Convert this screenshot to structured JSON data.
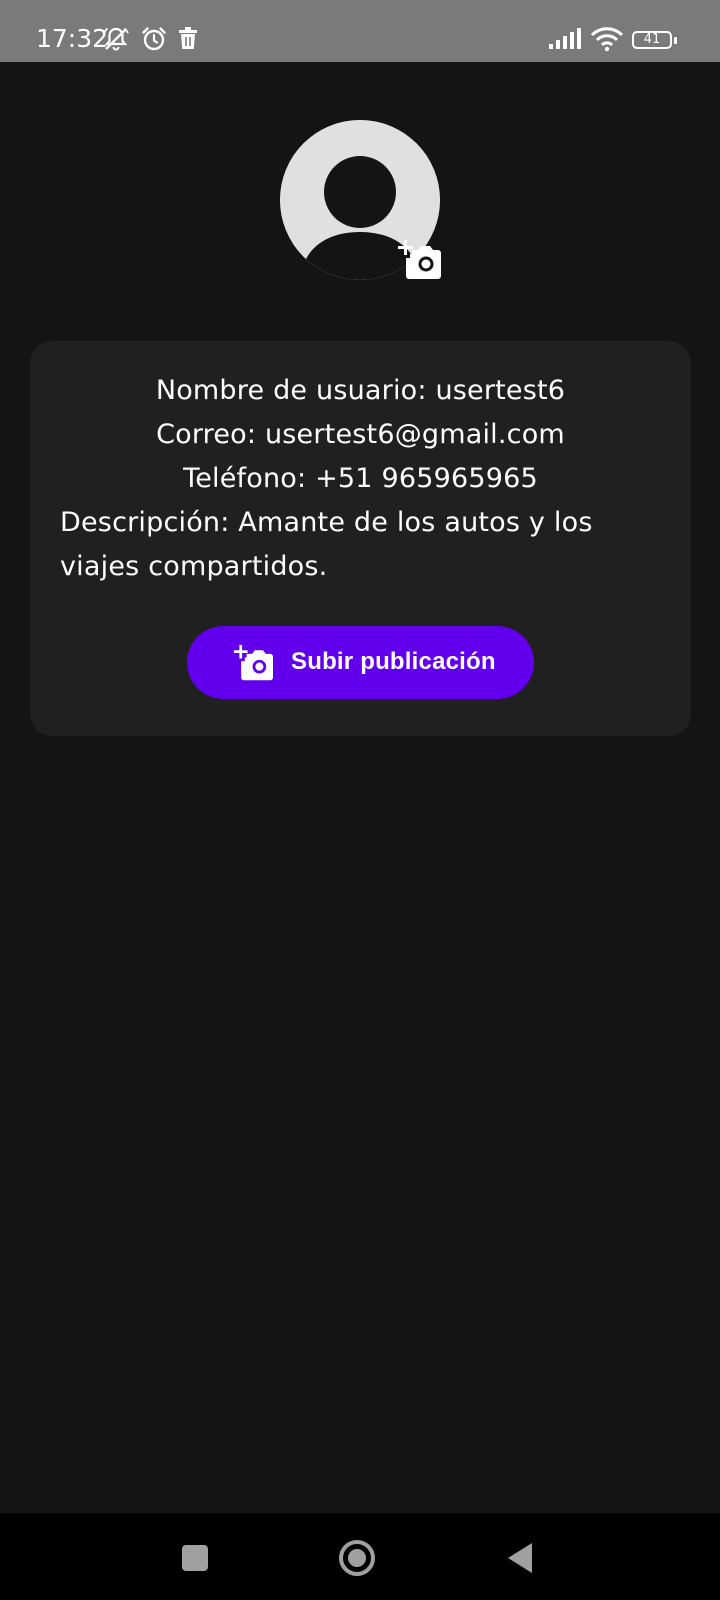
{
  "status_bar": {
    "time": "17:32",
    "battery_level": "41",
    "icons": [
      "bell-off-icon",
      "alarm-icon",
      "trash-icon",
      "signal-icon",
      "wifi-icon",
      "battery-icon"
    ]
  },
  "profile": {
    "avatar_icon": "person-avatar-icon",
    "avatar_action_icon": "add-photo-icon",
    "username_line": "Nombre de usuario: usertest6",
    "email_line": "Correo: usertest6@gmail.com",
    "phone_line": "Teléfono: +51 965965965",
    "description_line_1": "Descripción: Amante de los autos y los",
    "description_line_2": "viajes compartidos."
  },
  "actions": {
    "upload_label": "Subir publicación",
    "upload_icon": "add-photo-icon"
  },
  "nav_bar": {
    "icons": [
      "recent-apps-icon",
      "home-icon",
      "back-icon"
    ]
  },
  "colors": {
    "background": "#141414",
    "card": "#202020",
    "accent": "#6200ee",
    "status_bar": "#7a7a7a"
  }
}
